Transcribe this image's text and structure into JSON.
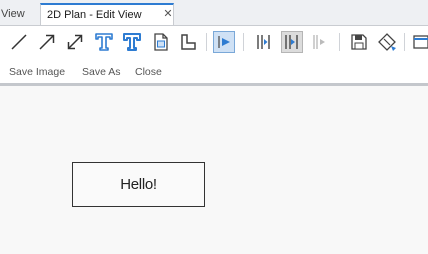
{
  "tabs": {
    "previous_tab_label": "View",
    "active_tab_label": "2D Plan - Edit View",
    "close_glyph": "✕"
  },
  "toolbar": {
    "icons": [
      "line-icon",
      "arrow-icon",
      "dimension-arrow-icon",
      "text-icon",
      "text-bold-icon",
      "insert-image-icon",
      "corner-icon",
      "select-pointer-icon",
      "align-left-icon",
      "align-center-icon",
      "align-right-icon",
      "save-image-icon",
      "save-as-icon",
      "close-view-icon"
    ],
    "commands": {
      "save_image": "Save Image",
      "save_as": "Save As",
      "close": "Close"
    }
  },
  "canvas": {
    "text_box_label": "Hello!"
  },
  "colors": {
    "accent_blue": "#2e7cd2",
    "active_tool_bg": "#cfe1f5",
    "canvas_bg": "#f8f8f8"
  }
}
